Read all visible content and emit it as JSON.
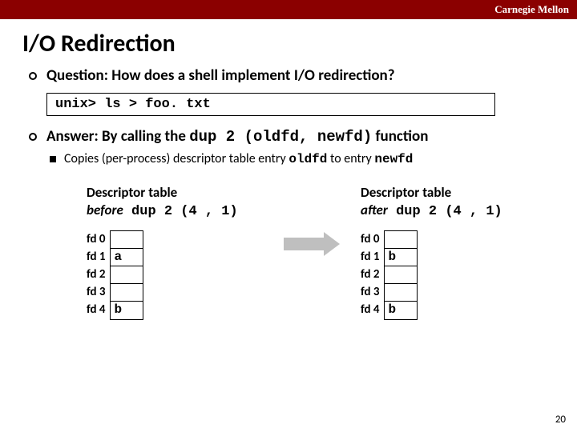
{
  "header": {
    "brand": "Carnegie Mellon"
  },
  "title": "I/O Redirection",
  "q": {
    "label": "Question: How does a shell implement I/O redirection?",
    "cmd": "unix> ls > foo. txt"
  },
  "a": {
    "prefix": "Answer: By calling the ",
    "fn": "dup 2 (oldfd, newfd)",
    "suffix": " function",
    "sub_prefix": "Copies (per-process) descriptor table entry ",
    "sub_old": "oldfd",
    "sub_mid": " to entry ",
    "sub_new": "newfd"
  },
  "tables": {
    "before": {
      "title_line1": "Descriptor table",
      "title_em": "before",
      "title_call": " dup 2 (4 , 1)",
      "rows": [
        "fd 0",
        "fd 1",
        "fd 2",
        "fd 3",
        "fd 4"
      ],
      "vals": [
        "",
        "a",
        "",
        "",
        "b"
      ]
    },
    "after": {
      "title_line1": "Descriptor table",
      "title_em": "after",
      "title_call": " dup 2 (4 , 1)",
      "rows": [
        "fd 0",
        "fd 1",
        "fd 2",
        "fd 3",
        "fd 4"
      ],
      "vals": [
        "",
        "b",
        "",
        "",
        "b"
      ]
    }
  },
  "page": "20"
}
